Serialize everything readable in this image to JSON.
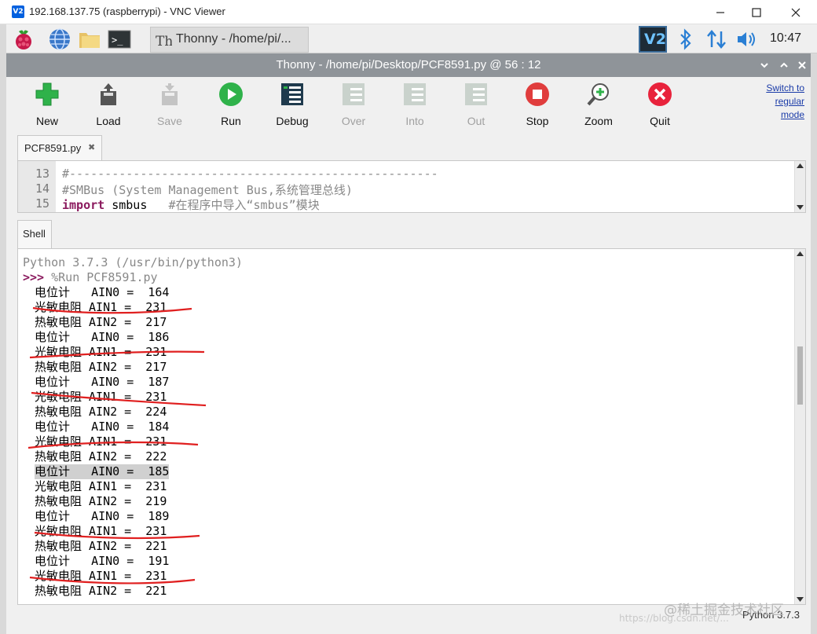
{
  "window": {
    "title": "192.168.137.75 (raspberrypi) - VNC Viewer",
    "app_icon": "V2"
  },
  "panel": {
    "task_label": "Thonny  -  /home/pi/...",
    "clock": "10:47"
  },
  "thonny": {
    "title": "Thonny  -  /home/pi/Desktop/PCF8591.py  @  56 : 12"
  },
  "toolbar": {
    "buttons": [
      {
        "label": "New",
        "icon": "new-plus-icon",
        "enabled": true
      },
      {
        "label": "Load",
        "icon": "load-icon",
        "enabled": true
      },
      {
        "label": "Save",
        "icon": "save-icon",
        "enabled": false
      },
      {
        "label": "Run",
        "icon": "run-icon",
        "enabled": true
      },
      {
        "label": "Debug",
        "icon": "debug-icon",
        "enabled": true
      },
      {
        "label": "Over",
        "icon": "step-over-icon",
        "enabled": false
      },
      {
        "label": "Into",
        "icon": "step-into-icon",
        "enabled": false
      },
      {
        "label": "Out",
        "icon": "step-out-icon",
        "enabled": false
      },
      {
        "label": "Stop",
        "icon": "stop-icon",
        "enabled": true
      },
      {
        "label": "Zoom",
        "icon": "zoom-icon",
        "enabled": true
      },
      {
        "label": "Quit",
        "icon": "quit-icon",
        "enabled": true
      }
    ],
    "switch_mode": [
      "Switch to",
      "regular",
      "mode"
    ]
  },
  "editor": {
    "tab_label": "PCF8591.py",
    "tab_close": "✖",
    "lines": [
      {
        "num": "13",
        "code": "#----------------------------------------------------"
      },
      {
        "num": "14",
        "code": "#SMBus (System Management Bus,系统管理总线)"
      },
      {
        "num": "15",
        "keyword": "import",
        "rest": " smbus",
        "comment": "   #在程序中导入“smbus”模块"
      }
    ]
  },
  "shell": {
    "tab_label": "Shell",
    "banner": "Python 3.7.3 (/usr/bin/python3)",
    "prompt": ">>>",
    "command": " %Run PCF8591.py",
    "output": [
      "电位计   AIN0 =  164",
      "光敏电阻 AIN1 =  231",
      "热敏电阻 AIN2 =  217",
      "电位计   AIN0 =  186",
      "光敏电阻 AIN1 =  231",
      "热敏电阻 AIN2 =  217",
      "电位计   AIN0 =  187",
      "光敏电阻 AIN1 =  231",
      "热敏电阻 AIN2 =  224",
      "电位计   AIN0 =  184",
      "光敏电阻 AIN1 =  231",
      "热敏电阻 AIN2 =  222",
      "电位计   AIN0 =  185",
      "光敏电阻 AIN1 =  231",
      "热敏电阻 AIN2 =  219",
      "电位计   AIN0 =  189",
      "光敏电阻 AIN1 =  231",
      "热敏电阻 AIN2 =  221",
      "电位计   AIN0 =  191",
      "光敏电阻 AIN1 =  231",
      "热敏电阻 AIN2 =  221"
    ]
  },
  "status": {
    "interpreter": "Python 3.7.3"
  },
  "watermark": {
    "text": "@稀土掘金技术社区",
    "url": "https://blog.csdn.net/..."
  }
}
